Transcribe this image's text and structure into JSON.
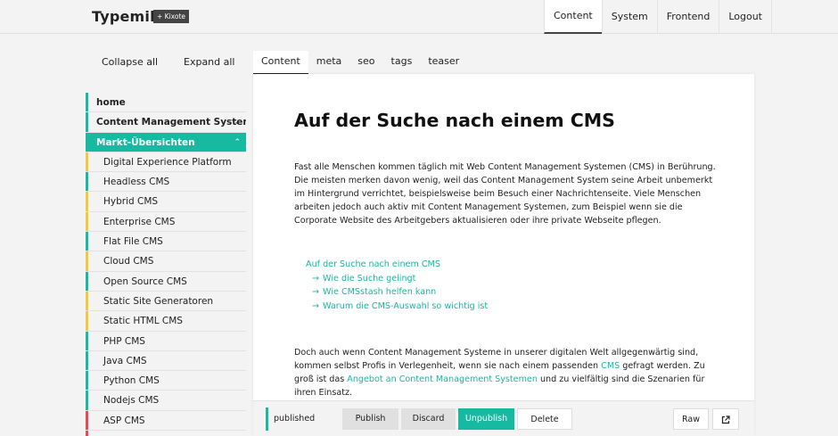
{
  "header": {
    "app_name": "Typemill",
    "badge": "+ Kixote",
    "nav": [
      "Content",
      "System",
      "Frontend",
      "Logout"
    ]
  },
  "sidebar": {
    "collapse_label": "Collapse all",
    "expand_label": "Expand all",
    "items": [
      {
        "label": "home",
        "level": 1,
        "bar": "#17b9a1"
      },
      {
        "label": "Content Management Systeme",
        "level": 1,
        "bar": "#17b9a1",
        "chevron": "chevron-down-icon"
      },
      {
        "label": "Markt-Übersichten",
        "level": 1,
        "bar": "#17b9a1",
        "selected": true,
        "chevron": "chevron-up-icon"
      },
      {
        "label": "Digital Experience Platform",
        "level": 2,
        "bar": "#f5c83a"
      },
      {
        "label": "Headless CMS",
        "level": 2,
        "bar": "#17b9a1"
      },
      {
        "label": "Hybrid CMS",
        "level": 2,
        "bar": "#f5c83a"
      },
      {
        "label": "Enterprise CMS",
        "level": 2,
        "bar": "#f5c83a"
      },
      {
        "label": "Flat File CMS",
        "level": 2,
        "bar": "#17b9a1"
      },
      {
        "label": "Cloud CMS",
        "level": 2,
        "bar": "#f5c83a"
      },
      {
        "label": "Open Source CMS",
        "level": 2,
        "bar": "#17b9a1"
      },
      {
        "label": "Static Site Generatoren",
        "level": 2,
        "bar": "#f5c83a"
      },
      {
        "label": "Static HTML CMS",
        "level": 2,
        "bar": "#f5c83a"
      },
      {
        "label": "PHP CMS",
        "level": 2,
        "bar": "#17b9a1"
      },
      {
        "label": "Java CMS",
        "level": 2,
        "bar": "#17b9a1"
      },
      {
        "label": "Python CMS",
        "level": 2,
        "bar": "#17b9a1"
      },
      {
        "label": "Nodejs CMS",
        "level": 2,
        "bar": "#17b9a1"
      },
      {
        "label": "ASP CMS",
        "level": 2,
        "bar": "#e04b5a"
      },
      {
        "label": "",
        "level": 2,
        "bar": "#e04b5a"
      }
    ]
  },
  "tabs": [
    "Content",
    "meta",
    "seo",
    "tags",
    "teaser"
  ],
  "content": {
    "title": "Auf der Suche nach einem CMS",
    "para1": "Fast alle Menschen kommen täglich mit Web Content Management Systemen (CMS) in Berührung. Die meisten merken davon wenig, weil das Content Management System seine Arbeit unbemerkt im Hintergrund verrichtet, beispielsweise beim Besuch einer Nachrichtenseite. Viele Menschen arbeiten jedoch auch aktiv mit Content Management Systemen, zum Beispiel wenn sie die Corporate Website des Arbeitgebers aktualisieren oder ihre private Webseite pflegen.",
    "toc": {
      "main": "Auf der Suche nach einem CMS",
      "arrow": "→",
      "subs": [
        "Wie die Suche gelingt",
        "Wie CMSstash helfen kann",
        "Warum die CMS-Auswahl so wichtig ist"
      ]
    },
    "para2": {
      "t1": "Doch auch wenn Content Management Systeme in unserer digitalen Welt allgegenwärtig sind, kommen selbst Profis in Verlegenheit, wenn sie nach einem passenden ",
      "link1": "CMS",
      "t2": " gefragt werden. Zu groß ist das ",
      "link2": "Angebot an Content Management Systemen",
      "t3": " und zu vielfältig sind die Szenarien für ihren Einsatz."
    }
  },
  "actions": {
    "status": "published",
    "publish": "Publish",
    "discard": "Discard",
    "unpublish": "Unpublish",
    "delete": "Delete",
    "raw": "Raw",
    "external_icon": "external-link-icon"
  },
  "colors": {
    "accent": "#17b9a1",
    "warning": "#f5c83a",
    "danger": "#e04b5a"
  }
}
